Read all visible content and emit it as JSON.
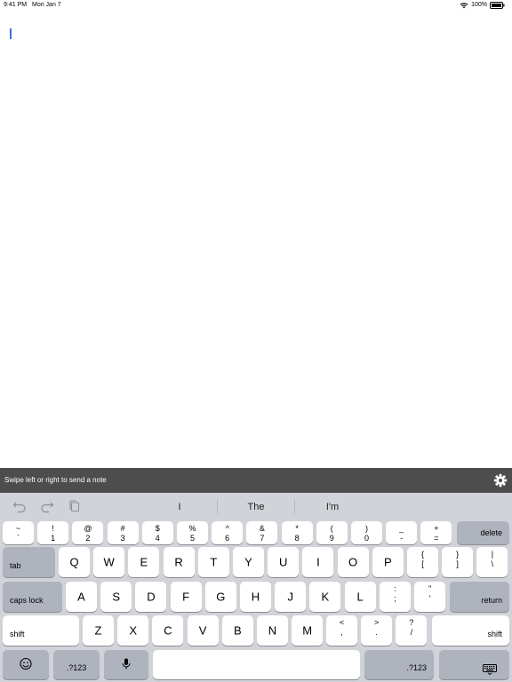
{
  "status_bar": {
    "time": "9:41 PM",
    "date": "Mon Jan 7",
    "battery": "100%"
  },
  "banner": {
    "text": "Swipe left or right to send a note",
    "icon": "gear-icon"
  },
  "toolbar": {
    "undo_icon": "undo-icon",
    "redo_icon": "redo-icon",
    "paste_icon": "paste-icon",
    "suggestions": [
      "I",
      "The",
      "I'm"
    ]
  },
  "keyboard": {
    "number_row": [
      {
        "top": "~",
        "bottom": "`"
      },
      {
        "top": "!",
        "bottom": "1"
      },
      {
        "top": "@",
        "bottom": "2"
      },
      {
        "top": "#",
        "bottom": "3"
      },
      {
        "top": "$",
        "bottom": "4"
      },
      {
        "top": "%",
        "bottom": "5"
      },
      {
        "top": "^",
        "bottom": "6"
      },
      {
        "top": "&",
        "bottom": "7"
      },
      {
        "top": "*",
        "bottom": "8"
      },
      {
        "top": "(",
        "bottom": "9"
      },
      {
        "top": ")",
        "bottom": "0"
      },
      {
        "top": "_",
        "bottom": "-"
      },
      {
        "top": "+",
        "bottom": "="
      }
    ],
    "delete_label": "delete",
    "tab_label": "tab",
    "row_q": [
      "Q",
      "W",
      "E",
      "R",
      "T",
      "Y",
      "U",
      "I",
      "O",
      "P"
    ],
    "row_q_symbols": [
      {
        "top": "{",
        "bottom": "["
      },
      {
        "top": "}",
        "bottom": "]"
      },
      {
        "top": "|",
        "bottom": "\\"
      }
    ],
    "caps_lock_label": "caps lock",
    "row_a": [
      "A",
      "S",
      "D",
      "F",
      "G",
      "H",
      "J",
      "K",
      "L"
    ],
    "row_a_symbols": [
      {
        "top": ":",
        "bottom": ";"
      },
      {
        "top": "\"",
        "bottom": "'"
      }
    ],
    "return_label": "return",
    "shift_label": "shift",
    "row_z": [
      "Z",
      "X",
      "C",
      "V",
      "B",
      "N",
      "M"
    ],
    "row_z_symbols": [
      {
        "top": "<",
        "bottom": ","
      },
      {
        "top": ">",
        "bottom": "."
      },
      {
        "top": "?",
        "bottom": "/"
      }
    ],
    "numbers_label": ".?123",
    "emoji_icon": "emoji-icon",
    "mic_icon": "microphone-icon",
    "dismiss_icon": "keyboard-dismiss-icon"
  }
}
